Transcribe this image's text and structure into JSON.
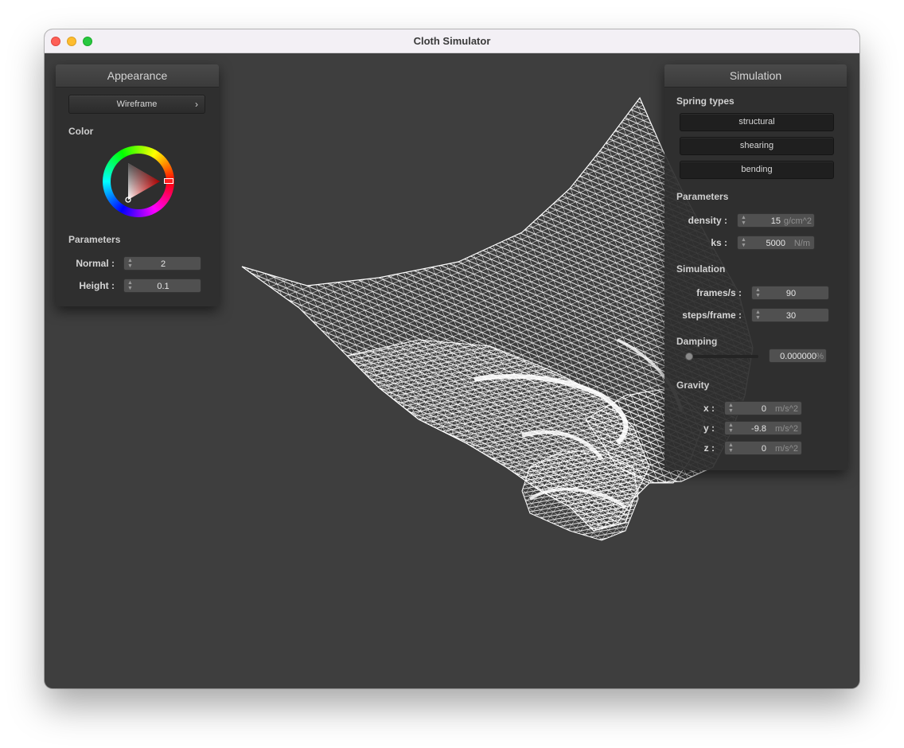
{
  "window": {
    "title": "Cloth Simulator"
  },
  "appearance": {
    "title": "Appearance",
    "shader_label": "Wireframe",
    "color_label": "Color",
    "selected_color": "#ff0000",
    "parameters_label": "Parameters",
    "normal_label": "Normal :",
    "normal_value": "2",
    "height_label": "Height :",
    "height_value": "0.1"
  },
  "simulation": {
    "title": "Simulation",
    "spring_types_label": "Spring types",
    "spring_types": [
      "structural",
      "shearing",
      "bending"
    ],
    "parameters_label": "Parameters",
    "density_label": "density :",
    "density_value": "15",
    "density_unit": "g/cm^2",
    "ks_label": "ks :",
    "ks_value": "5000",
    "ks_unit": "N/m",
    "simulation_label": "Simulation",
    "fps_label": "frames/s :",
    "fps_value": "90",
    "steps_label": "steps/frame :",
    "steps_value": "30",
    "damping_label": "Damping",
    "damping_value": "0.000000",
    "damping_unit": "%",
    "damping_fraction": 0,
    "gravity_label": "Gravity",
    "gx_label": "x :",
    "gx_value": "0",
    "gy_label": "y :",
    "gy_value": "-9.8",
    "gz_label": "z :",
    "gz_value": "0",
    "gravity_unit": "m/s^2"
  },
  "scene": {
    "cloth_color": "#ffffff",
    "background": "#3e3e3e"
  }
}
